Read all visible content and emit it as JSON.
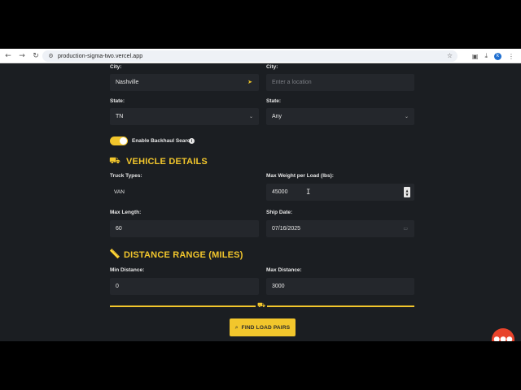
{
  "browser": {
    "url": "production-sigma-two.vercel.app",
    "profile_initial": "k"
  },
  "origin": {
    "city_label": "City:",
    "city_value": "Nashville",
    "state_label": "State:",
    "state_value": "TN"
  },
  "destination": {
    "city_label": "City:",
    "city_placeholder": "Enter a location",
    "state_label": "State:",
    "state_value": "Any"
  },
  "backhaul": {
    "label": "Enable Backhaul Search",
    "enabled": true
  },
  "vehicle": {
    "title": "VEHICLE DETAILS",
    "truck_types_label": "Truck Types:",
    "truck_types_value": "VAN",
    "max_weight_label": "Max Weight per Load (lbs):",
    "max_weight_value": "45000",
    "max_length_label": "Max Length:",
    "max_length_value": "60",
    "ship_date_label": "Ship Date:",
    "ship_date_value": "07/16/2025"
  },
  "distance": {
    "title": "DISTANCE RANGE (MILES)",
    "min_label": "Min Distance:",
    "min_value": "0",
    "max_label": "Max Distance:",
    "max_value": "3000"
  },
  "find_button_label": "FIND LOAD PAIRS",
  "colors": {
    "accent": "#f2c62c",
    "background": "#1b1e22",
    "field": "#24272c",
    "chat": "#e8432b"
  }
}
